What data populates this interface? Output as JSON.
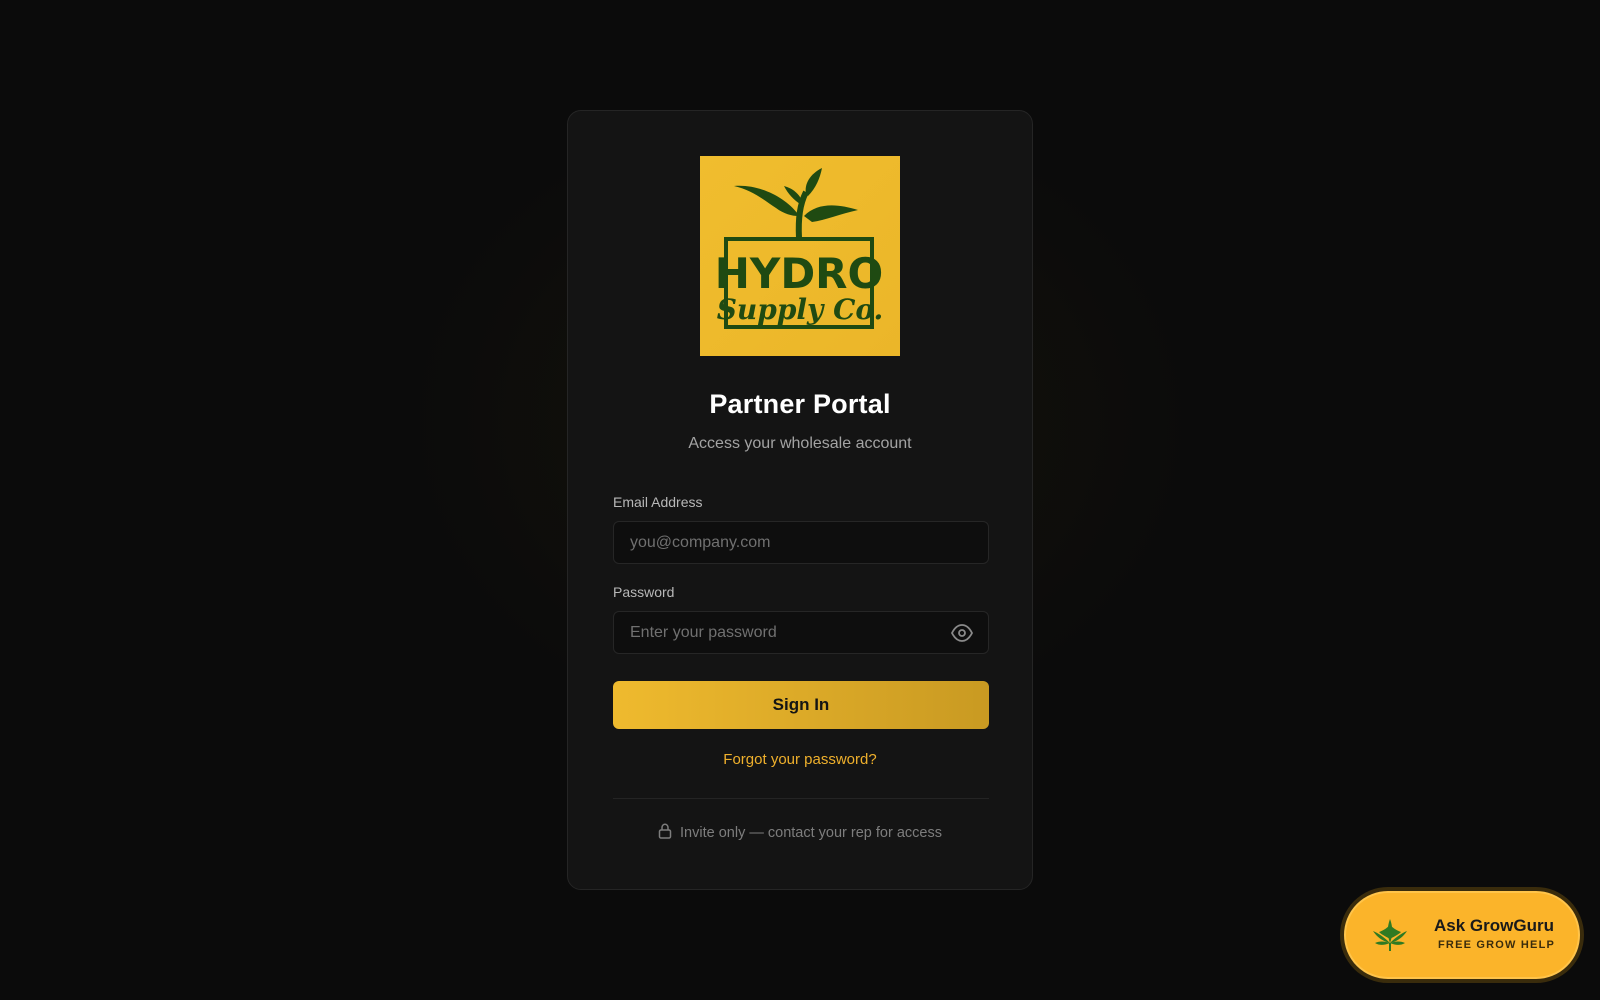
{
  "brand": {
    "logo_line1": "HYDRO",
    "logo_line2": "Supply Co.",
    "logo_bg": "#f0bd2e",
    "logo_ink": "#1f4a12"
  },
  "header": {
    "title": "Partner Portal",
    "subtitle": "Access your wholesale account"
  },
  "form": {
    "email_label": "Email Address",
    "email_placeholder": "you@company.com",
    "email_value": "",
    "password_label": "Password",
    "password_placeholder": "Enter your password",
    "password_value": "",
    "show_password_icon": "eye-icon",
    "submit_label": "Sign In",
    "forgot_label": "Forgot your password?"
  },
  "footer": {
    "lock_icon": "lock-icon",
    "invite_text": "Invite only — contact your rep for access"
  },
  "chat_widget": {
    "icon": "cannabis-leaf-icon",
    "title": "Ask GrowGuru",
    "subtitle": "FREE GROW HELP"
  },
  "colors": {
    "background": "#0b0b0b",
    "card": "#141414",
    "accent": "#efba2e",
    "link": "#efb02c",
    "widget": "#fbb42a"
  }
}
